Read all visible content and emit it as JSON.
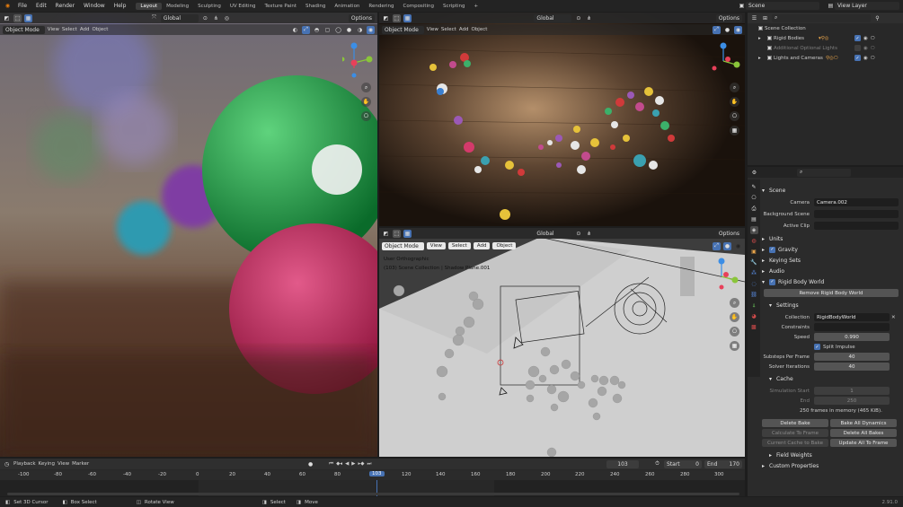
{
  "topbar": {
    "menus": [
      "File",
      "Edit",
      "Render",
      "Window",
      "Help"
    ],
    "workspaces": [
      "Layout",
      "Modeling",
      "Sculpting",
      "UV Editing",
      "Texture Paint",
      "Shading",
      "Animation",
      "Rendering",
      "Compositing",
      "Scripting"
    ],
    "active_workspace": "Layout",
    "add_workspace": "+",
    "scene": "Scene",
    "view_layer": "View Layer"
  },
  "viewport_left": {
    "orientation": "Global",
    "options": "Options",
    "mode": "Object Mode",
    "menus": [
      "View",
      "Select",
      "Add",
      "Object"
    ]
  },
  "viewport_top_right": {
    "orientation": "Global",
    "options": "Options",
    "mode": "Object Mode",
    "menus": [
      "View",
      "Select",
      "Add",
      "Object"
    ]
  },
  "viewport_bottom": {
    "orientation": "Global",
    "options": "Options",
    "mode": "Object Mode",
    "menus": [
      "View",
      "Select",
      "Add",
      "Object"
    ],
    "overlay_line1": "User Orthographic",
    "overlay_line2": "(103) Scene Collection | Shadow Plane.001"
  },
  "outliner": {
    "root": "Scene Collection",
    "items": [
      {
        "label": "Rigid Bodies",
        "dim": false
      },
      {
        "label": "Additional Optional Lights",
        "dim": true
      },
      {
        "label": "Lights and Cameras",
        "dim": false
      }
    ]
  },
  "properties": {
    "scene_header": "Scene",
    "camera_label": "Camera",
    "camera_value": "Camera.002",
    "background_scene_label": "Background Scene",
    "active_clip_label": "Active Clip",
    "units": "Units",
    "gravity": "Gravity",
    "keying_sets": "Keying Sets",
    "audio": "Audio",
    "rigid_body_world": "Rigid Body World",
    "remove_rbw": "Remove Rigid Body World",
    "settings": "Settings",
    "collection_label": "Collection",
    "collection_value": "RigidBodyWorld",
    "constraints_label": "Constraints",
    "speed_label": "Speed",
    "speed_value": "0.990",
    "split_impulse": "Split Impulse",
    "substeps_label": "Substeps Per Frame",
    "substeps_value": "40",
    "solver_label": "Solver Iterations",
    "solver_value": "40",
    "cache": "Cache",
    "sim_start_label": "Simulation Start",
    "sim_start_value": "1",
    "end_label": "End",
    "end_value": "250",
    "cache_info": "250 frames in memory (465 KiB).",
    "delete_bake": "Delete Bake",
    "bake_all_dynamics": "Bake All Dynamics",
    "calculate_to_frame": "Calculate To Frame",
    "delete_all_bakes": "Delete All Bakes",
    "current_cache_to_bake": "Current Cache to Bake",
    "update_all_to_frame": "Update All To Frame",
    "field_weights": "Field Weights",
    "custom_properties": "Custom Properties"
  },
  "timeline": {
    "menus": [
      "Playback",
      "Keying",
      "View",
      "Marker"
    ],
    "current_frame": "103",
    "start_label": "Start",
    "start_value": "0",
    "end_label": "End",
    "end_value": "170",
    "ticks": [
      "-100",
      "-80",
      "-60",
      "-40",
      "-20",
      "0",
      "20",
      "40",
      "60",
      "80",
      "103",
      "120",
      "140",
      "160",
      "180",
      "200",
      "220",
      "240",
      "260",
      "280",
      "300"
    ]
  },
  "statusbar": {
    "hints": [
      "Set 3D Cursor",
      "Box Select",
      "Rotate View",
      "Select",
      "Move"
    ],
    "version": "2.91.0"
  },
  "colors": {
    "accent_blue": "#4772b3",
    "playhead": "#4772b3",
    "panel_bg": "#2f2f2f",
    "app_bg": "#1d1d1d"
  }
}
